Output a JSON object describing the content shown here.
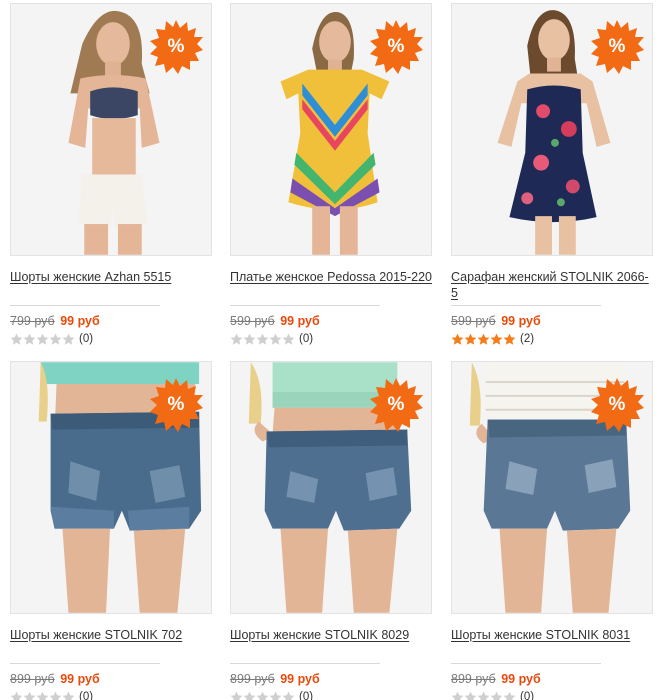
{
  "badge_text": "%",
  "colors": {
    "accent": "#e84a0c",
    "badge": "#f26a13",
    "star_on": "#f47d19",
    "star_off": "#cfcfcf"
  },
  "products": [
    {
      "title": "Шорты женские Azhan 5515",
      "old_price": "799 руб",
      "new_price": "99 руб",
      "rating": 0,
      "reviews": "(0)"
    },
    {
      "title": "Платье женское Pedossa 2015-220",
      "old_price": "599 руб",
      "new_price": "99 руб",
      "rating": 0,
      "reviews": "(0)"
    },
    {
      "title": "Сарафан женский STOLNIK 2066-5",
      "old_price": "599 руб",
      "new_price": "99 руб",
      "rating": 5,
      "reviews": "(2)"
    },
    {
      "title": "Шорты женские STOLNIK 702",
      "old_price": "899 руб",
      "new_price": "99 руб",
      "rating": 0,
      "reviews": "(0)"
    },
    {
      "title": "Шорты женские STOLNIK 8029",
      "old_price": "899 руб",
      "new_price": "99 руб",
      "rating": 0,
      "reviews": "(0)"
    },
    {
      "title": "Шорты женские STOLNIK 8031",
      "old_price": "899 руб",
      "new_price": "99 руб",
      "rating": 0,
      "reviews": "(0)"
    }
  ]
}
